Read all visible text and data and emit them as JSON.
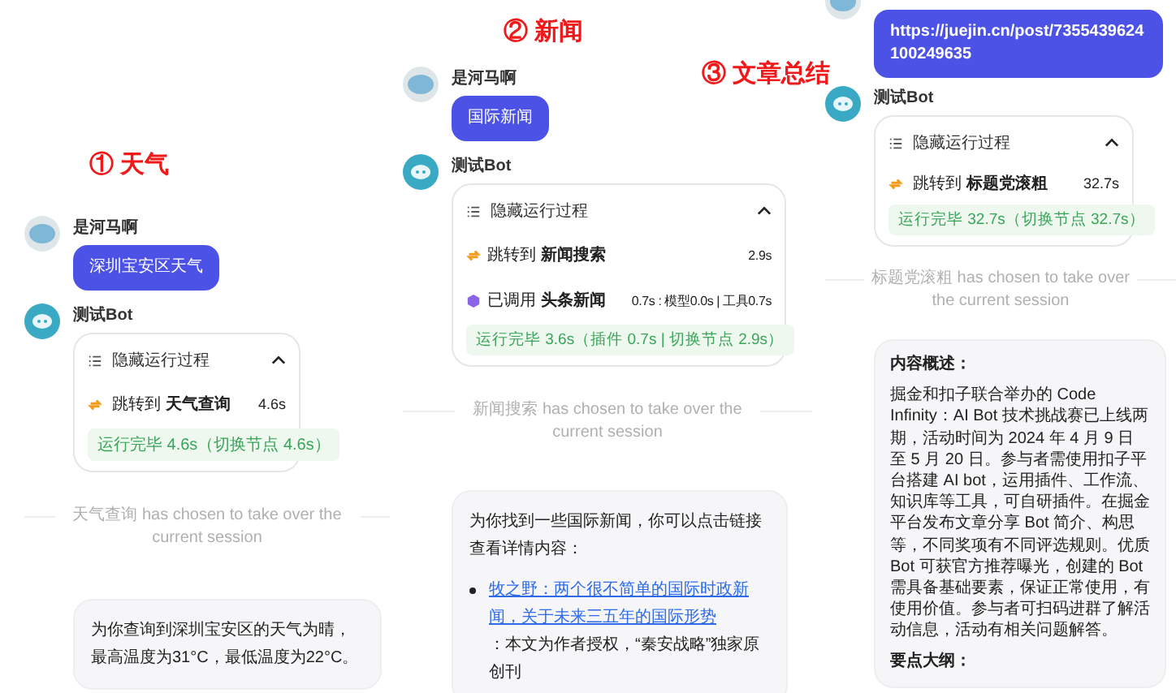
{
  "panels": [
    {
      "title": "① 天气",
      "user": {
        "name": "是河马啊",
        "message": "深圳宝安区天气"
      },
      "bot": {
        "name": "测试Bot",
        "process": {
          "toggle_label": "隐藏运行过程",
          "expanded": true,
          "steps": [
            {
              "kind": "jump",
              "action": "跳转到",
              "target": "天气查询",
              "time": "4.6s"
            }
          ],
          "summary": "运行完毕 4.6s（切换节点 4.6s）"
        }
      },
      "handover": {
        "agent": "天气查询",
        "text": "has chosen to take over the current session"
      },
      "answer": [
        {
          "kind": "paragraph",
          "text": "为你查询到深圳宝安区的天气为晴，最高温度为31°C，最低温度为22°C。"
        }
      ]
    },
    {
      "title": "② 新闻",
      "user": {
        "name": "是河马啊",
        "message": "国际新闻"
      },
      "bot": {
        "name": "测试Bot",
        "process": {
          "toggle_label": "隐藏运行过程",
          "expanded": true,
          "steps": [
            {
              "kind": "jump",
              "action": "跳转到",
              "target": "新闻搜索",
              "time": "2.9s"
            },
            {
              "kind": "plugin",
              "action": "已调用",
              "target": "头条新闻",
              "time": "0.7s : 模型0.0s | 工具0.7s"
            }
          ],
          "summary": "运行完毕 3.6s（插件 0.7s | 切换节点 2.9s）"
        }
      },
      "handover": {
        "agent": "新闻搜索",
        "text": "has chosen to take over the current session"
      },
      "answer": [
        {
          "kind": "paragraph",
          "text": "为你找到一些国际新闻，你可以点击链接查看详情内容："
        },
        {
          "kind": "bullet",
          "link": "牧之野：两个很不简单的国际时政新闻，关于未来三五年的国际形势",
          "text": "：本文为作者授权，“秦安战略”独家原创刊"
        }
      ]
    },
    {
      "title": "③ 文章总结",
      "user": {
        "message": "https://juejin.cn/post/7355439624100249635"
      },
      "bot": {
        "name": "测试Bot",
        "process": {
          "toggle_label": "隐藏运行过程",
          "expanded": true,
          "steps": [
            {
              "kind": "jump",
              "action": "跳转到",
              "target": "标题党滚粗",
              "time": "32.7s"
            }
          ],
          "summary": "运行完毕 32.7s（切换节点 32.7s）"
        }
      },
      "handover": {
        "agent": "标题党滚粗",
        "text": "has chosen to take over the current session"
      },
      "answer": [
        {
          "kind": "heading",
          "text": "内容概述："
        },
        {
          "kind": "paragraph",
          "text": "掘金和扣子联合举办的 Code Infinity：AI Bot 技术挑战赛已上线两期，活动时间为 2024 年 4 月 9 日至 5 月 20 日。参与者需使用扣子平台搭建 AI bot，运用插件、工作流、知识库等工具，可自研插件。在掘金平台发布文章分享 Bot 简介、构思等，不同奖项有不同评选规则。优质 Bot 可获官方推荐曝光，创建的 Bot 需具备基础要素，保证正常使用，有使用价值。参与者可扫码进群了解活动信息，活动有相关问题解答。"
        },
        {
          "kind": "heading",
          "text": "要点大纲："
        }
      ]
    }
  ]
}
